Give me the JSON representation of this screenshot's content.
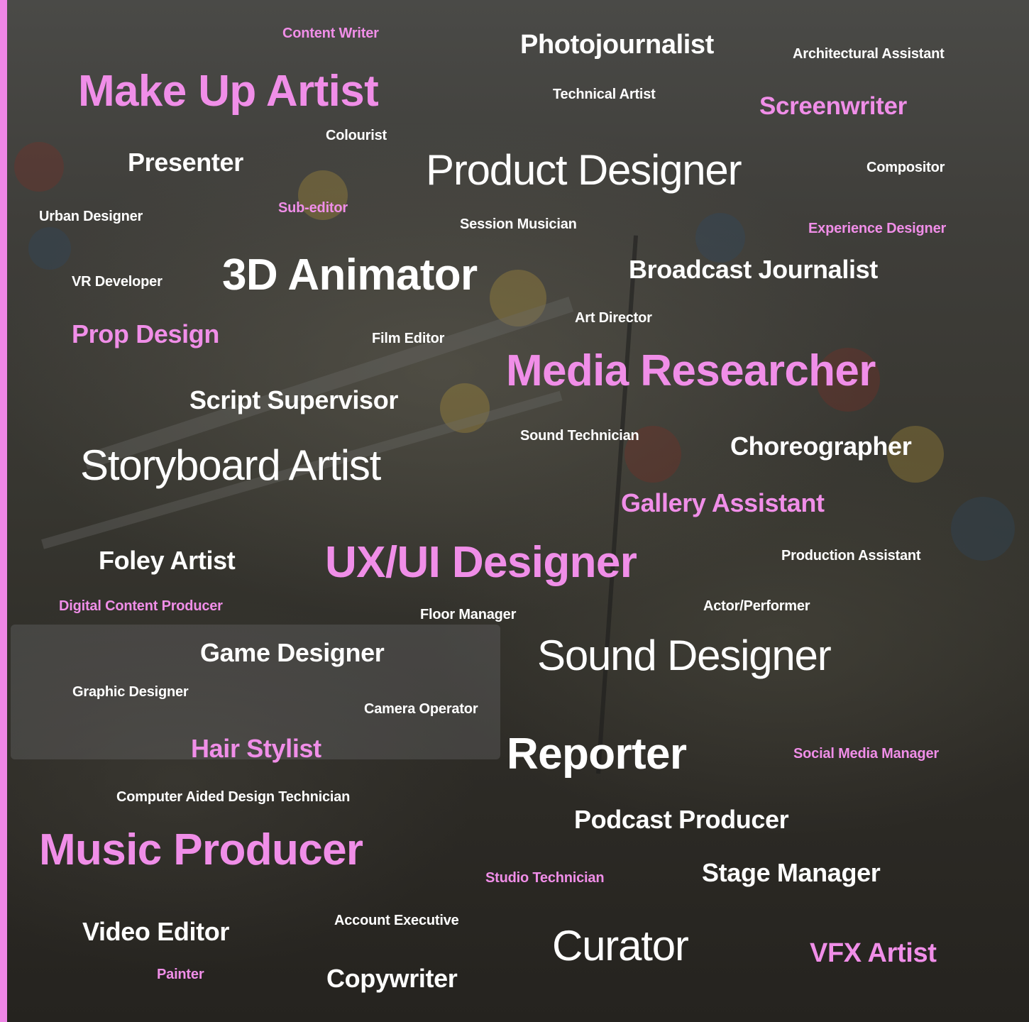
{
  "colors": {
    "white": "#ffffff",
    "pink": "#f08ee8",
    "accent_bar": "#ef86e6"
  },
  "words": {
    "content_writer": "Content Writer",
    "photojournalist": "Photojournalist",
    "architectural_assistant": "Architectural Assistant",
    "make_up_artist": "Make Up Artist",
    "technical_artist": "Technical Artist",
    "screenwriter": "Screenwriter",
    "colourist": "Colourist",
    "presenter": "Presenter",
    "product_designer": "Product Designer",
    "compositor": "Compositor",
    "urban_designer": "Urban Designer",
    "sub_editor": "Sub-editor",
    "session_musician": "Session Musician",
    "experience_designer": "Experience Designer",
    "vr_developer": "VR Developer",
    "animator_3d": "3D Animator",
    "broadcast_journalist": "Broadcast Journalist",
    "art_director": "Art Director",
    "prop_design": "Prop Design",
    "film_editor": "Film Editor",
    "media_researcher": "Media Researcher",
    "script_supervisor": "Script Supervisor",
    "sound_technician": "Sound Technician",
    "choreographer": "Choreographer",
    "storyboard_artist": "Storyboard Artist",
    "gallery_assistant": "Gallery Assistant",
    "foley_artist": "Foley Artist",
    "ux_ui_designer": "UX/UI Designer",
    "production_assistant": "Production Assistant",
    "digital_content_producer": "Digital Content Producer",
    "floor_manager": "Floor Manager",
    "actor_performer": "Actor/Performer",
    "game_designer": "Game Designer",
    "sound_designer": "Sound Designer",
    "graphic_designer": "Graphic Designer",
    "camera_operator": "Camera Operator",
    "hair_stylist": "Hair Stylist",
    "reporter": "Reporter",
    "social_media_manager": "Social Media Manager",
    "cad_technician": "Computer Aided Design Technician",
    "podcast_producer": "Podcast Producer",
    "music_producer": "Music Producer",
    "studio_technician": "Studio Technician",
    "stage_manager": "Stage Manager",
    "video_editor": "Video Editor",
    "account_executive": "Account Executive",
    "curator": "Curator",
    "vfx_artist": "VFX Artist",
    "painter": "Painter",
    "copywriter": "Copywriter"
  }
}
